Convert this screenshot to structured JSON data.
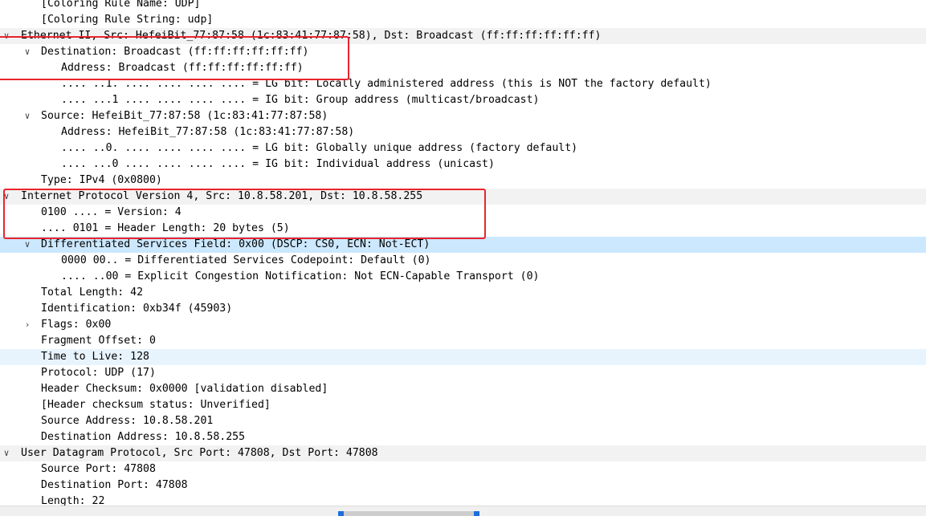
{
  "tree": {
    "rows": [
      {
        "level": 1,
        "arrow": "",
        "text": "[Coloring Rule Name: UDP]",
        "state": ""
      },
      {
        "level": 1,
        "arrow": "",
        "text": "[Coloring Rule String: udp]",
        "state": ""
      },
      {
        "level": 0,
        "arrow": "expanded",
        "text": "Ethernet II, Src: HefeiBit_77:87:58 (1c:83:41:77:87:58), Dst: Broadcast (ff:ff:ff:ff:ff:ff)",
        "state": ""
      },
      {
        "level": 1,
        "arrow": "expanded",
        "text": "Destination: Broadcast (ff:ff:ff:ff:ff:ff)",
        "state": ""
      },
      {
        "level": 2,
        "arrow": "",
        "text": "Address: Broadcast (ff:ff:ff:ff:ff:ff)",
        "state": ""
      },
      {
        "level": 2,
        "arrow": "",
        "text": ".... ..1. .... .... .... .... = LG bit: Locally administered address (this is NOT the factory default)",
        "state": ""
      },
      {
        "level": 2,
        "arrow": "",
        "text": ".... ...1 .... .... .... .... = IG bit: Group address (multicast/broadcast)",
        "state": ""
      },
      {
        "level": 1,
        "arrow": "expanded",
        "text": "Source: HefeiBit_77:87:58 (1c:83:41:77:87:58)",
        "state": ""
      },
      {
        "level": 2,
        "arrow": "",
        "text": "Address: HefeiBit_77:87:58 (1c:83:41:77:87:58)",
        "state": ""
      },
      {
        "level": 2,
        "arrow": "",
        "text": ".... ..0. .... .... .... .... = LG bit: Globally unique address (factory default)",
        "state": ""
      },
      {
        "level": 2,
        "arrow": "",
        "text": ".... ...0 .... .... .... .... = IG bit: Individual address (unicast)",
        "state": ""
      },
      {
        "level": 1,
        "arrow": "",
        "text": "Type: IPv4 (0x0800)",
        "state": ""
      },
      {
        "level": 0,
        "arrow": "expanded",
        "text": "Internet Protocol Version 4, Src: 10.8.58.201, Dst: 10.8.58.255",
        "state": ""
      },
      {
        "level": 1,
        "arrow": "",
        "text": "0100 .... = Version: 4",
        "state": ""
      },
      {
        "level": 1,
        "arrow": "",
        "text": ".... 0101 = Header Length: 20 bytes (5)",
        "state": ""
      },
      {
        "level": 1,
        "arrow": "expanded",
        "text": "Differentiated Services Field: 0x00 (DSCP: CS0, ECN: Not-ECT)",
        "state": "selected"
      },
      {
        "level": 2,
        "arrow": "",
        "text": "0000 00.. = Differentiated Services Codepoint: Default (0)",
        "state": ""
      },
      {
        "level": 2,
        "arrow": "",
        "text": ".... ..00 = Explicit Congestion Notification: Not ECN-Capable Transport (0)",
        "state": ""
      },
      {
        "level": 1,
        "arrow": "",
        "text": "Total Length: 42",
        "state": ""
      },
      {
        "level": 1,
        "arrow": "",
        "text": "Identification: 0xb34f (45903)",
        "state": ""
      },
      {
        "level": 1,
        "arrow": "collapsed",
        "text": "Flags: 0x00",
        "state": ""
      },
      {
        "level": 1,
        "arrow": "",
        "text": "Fragment Offset: 0",
        "state": ""
      },
      {
        "level": 1,
        "arrow": "",
        "text": "Time to Live: 128",
        "state": "highlighted"
      },
      {
        "level": 1,
        "arrow": "",
        "text": "Protocol: UDP (17)",
        "state": ""
      },
      {
        "level": 1,
        "arrow": "",
        "text": "Header Checksum: 0x0000 [validation disabled]",
        "state": ""
      },
      {
        "level": 1,
        "arrow": "",
        "text": "[Header checksum status: Unverified]",
        "state": ""
      },
      {
        "level": 1,
        "arrow": "",
        "text": "Source Address: 10.8.58.201",
        "state": ""
      },
      {
        "level": 1,
        "arrow": "",
        "text": "Destination Address: 10.8.58.255",
        "state": ""
      },
      {
        "level": 0,
        "arrow": "expanded",
        "text": "User Datagram Protocol, Src Port: 47808, Dst Port: 47808",
        "state": ""
      },
      {
        "level": 1,
        "arrow": "",
        "text": "Source Port: 47808",
        "state": ""
      },
      {
        "level": 1,
        "arrow": "",
        "text": "Destination Port: 47808",
        "state": ""
      },
      {
        "level": 1,
        "arrow": "",
        "text": "Length: 22",
        "state": ""
      }
    ]
  },
  "icons": {
    "expanded": "chevron-down-icon",
    "collapsed": "chevron-right-icon"
  },
  "colors": {
    "annotation": "#e8252e",
    "selected_row": "#cce8ff",
    "highlighted_row": "#e8f4fd",
    "top_level_row": "#f2f2f2",
    "scroll_marker": "#1e6fd9"
  }
}
